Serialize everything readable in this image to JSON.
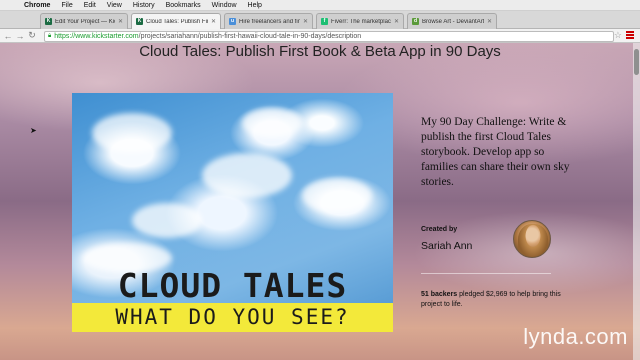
{
  "menubar": {
    "app": "Chrome",
    "items": [
      "File",
      "Edit",
      "View",
      "History",
      "Bookmarks",
      "Window",
      "Help"
    ]
  },
  "tabs": [
    {
      "label": "Edit Your Project — Kicks",
      "favicon": "K",
      "favicon_color": "#1b6b43",
      "active": false
    },
    {
      "label": "Cloud Tales: Publish First B",
      "favicon": "K",
      "favicon_color": "#1b6b43",
      "active": true
    },
    {
      "label": "Hire freelancers and find fr",
      "favicon": "u",
      "favicon_color": "#4a8fd9",
      "active": false
    },
    {
      "label": "Fiverr: The marketplace fo",
      "favicon": "f",
      "favicon_color": "#1dbf73",
      "active": false
    },
    {
      "label": "Browse Art - DeviantArt",
      "favicon": "d",
      "favicon_color": "#5b9a3a",
      "active": false
    }
  ],
  "address": {
    "host": "https://www.kickstarter.com",
    "path": "/projects/sariahann/publish-first-hawaii-cloud-tale-in-90-days/description"
  },
  "page": {
    "title": "Cloud Tales: Publish First Book & Beta App in 90 Days",
    "cover_title": "CLOUD TALES",
    "cover_subtitle": "WHAT DO YOU SEE?",
    "blurb": "My 90 Day Challenge: Write & publish the first Cloud Tales storybook. Develop app so families can share their own sky stories.",
    "created_by_label": "Created by",
    "creator_name": "Sariah Ann",
    "backers_count": "51 backers",
    "backers_text": " pledged $2,969 to help bring this project to life."
  },
  "watermark": "lynda.com",
  "colors": {
    "kickstarter_green": "#1a9c2e",
    "cover_band": "#f3e93a"
  }
}
